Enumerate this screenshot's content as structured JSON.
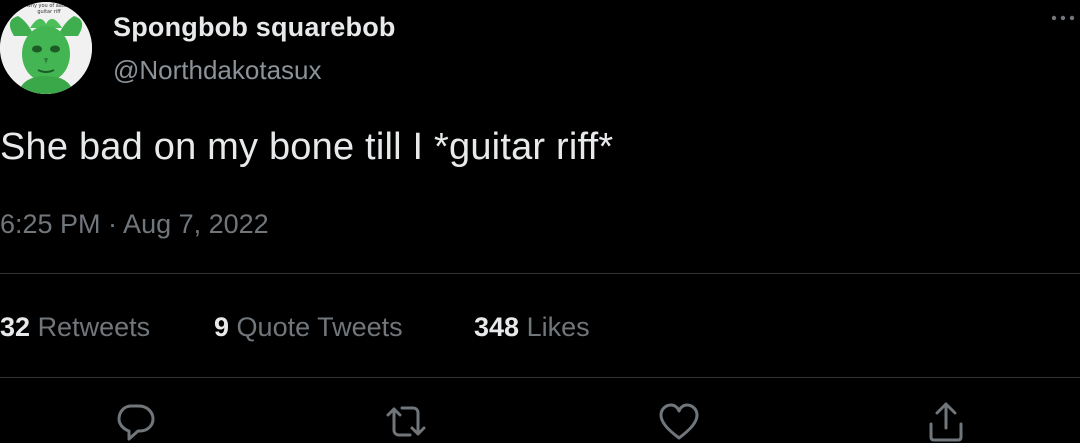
{
  "user": {
    "display_name": "Spongbob squarebob",
    "handle": "@Northdakotasux",
    "avatar_caption": "ly why you of aaaaaaa guitar riff"
  },
  "tweet": {
    "text": "She bad on my bone till I *guitar riff*",
    "timestamp": "6:25 PM · Aug 7, 2022"
  },
  "stats": {
    "retweets": {
      "count": "32",
      "label": "Retweets"
    },
    "quotes": {
      "count": "9",
      "label": "Quote Tweets"
    },
    "likes": {
      "count": "348",
      "label": "Likes"
    }
  },
  "actions": [
    "reply-icon",
    "retweet-icon",
    "like-icon",
    "share-icon"
  ],
  "colors": {
    "background": "#000000",
    "text_primary": "#e7e9ea",
    "text_secondary": "#71767b",
    "divider": "#2f3336",
    "avatar_green": "#3fae4e"
  }
}
